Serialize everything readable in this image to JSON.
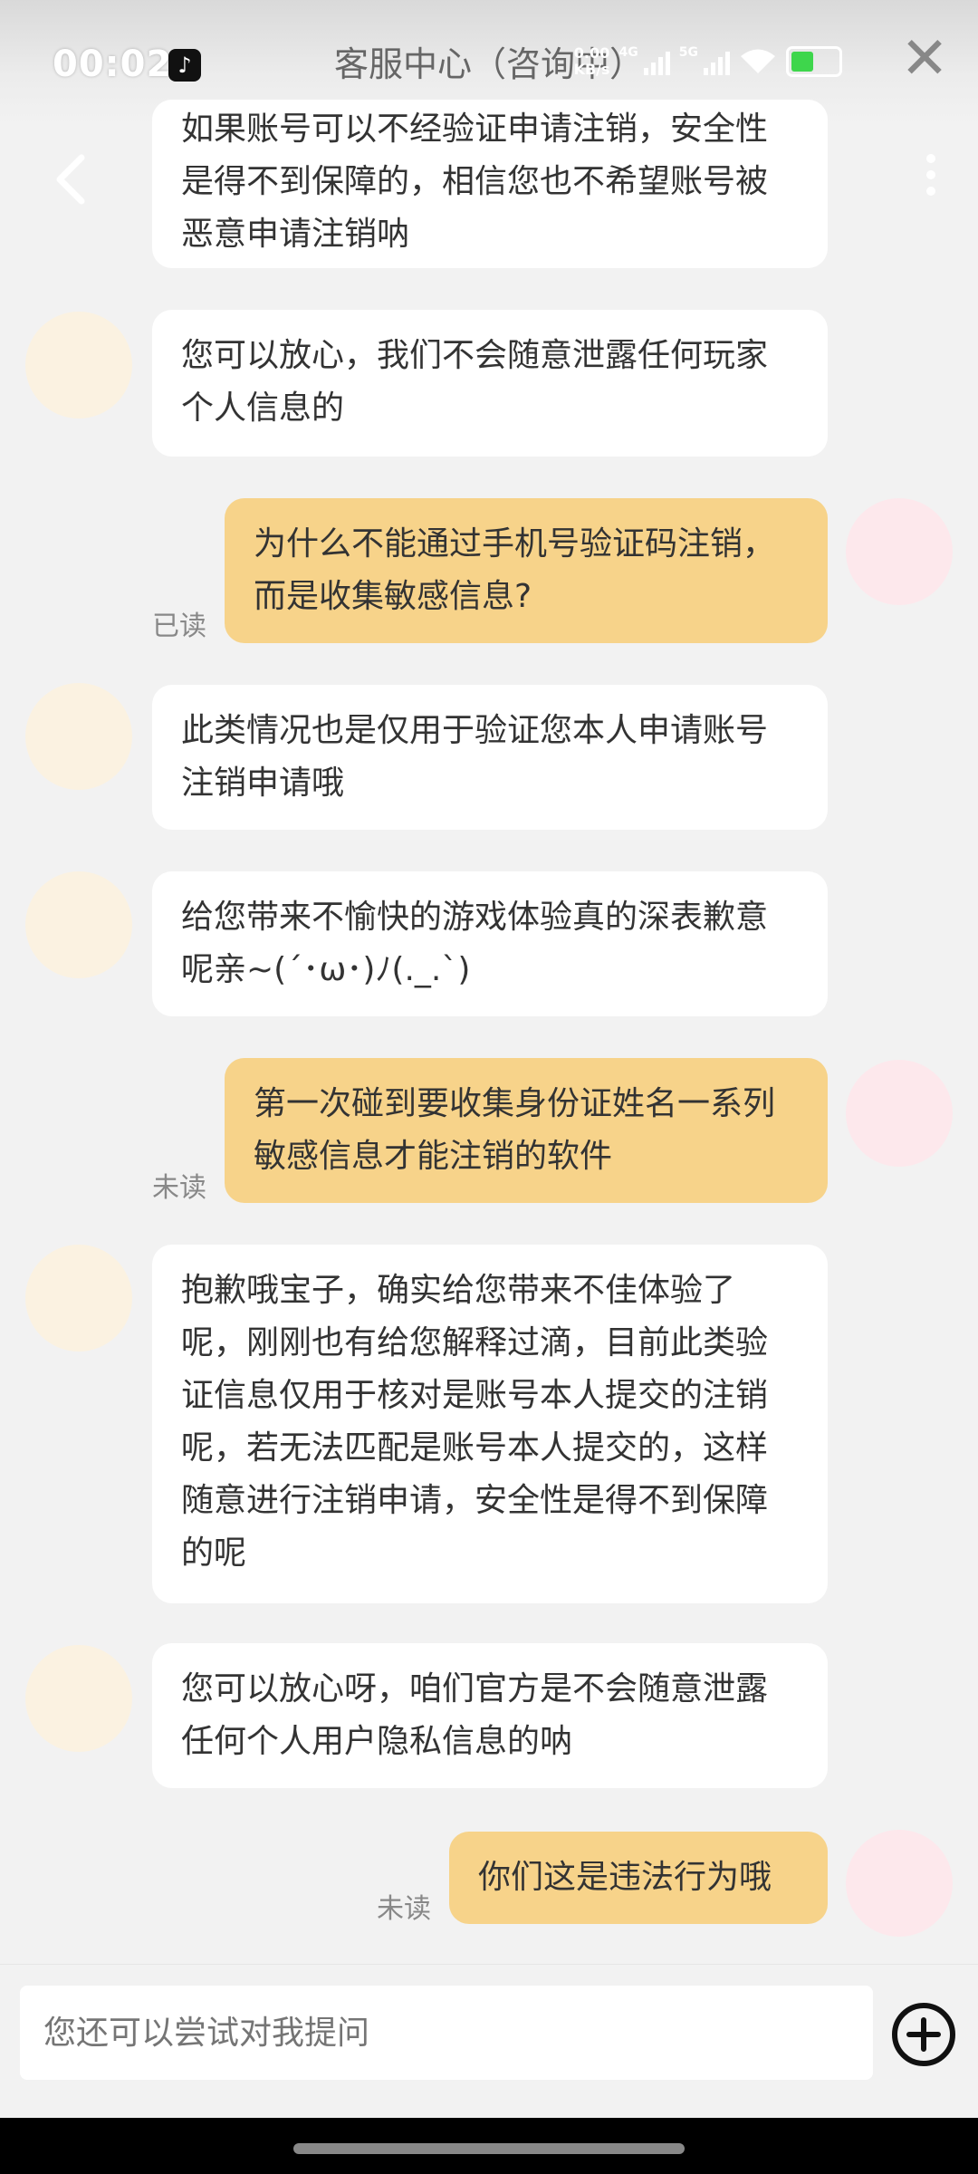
{
  "status_bar": {
    "time": "00:02",
    "speed": "0.00",
    "speed_unit": "KB/s",
    "net1": "4G",
    "net2": "5G"
  },
  "header": {
    "title": "客服中心（咨询中）"
  },
  "messages": [
    {
      "from": "bot",
      "text": "如果账号可以不经验证申请注销，安全性是得不到保障的，相信您也不希望账号被恶意申请注销呐"
    },
    {
      "from": "bot",
      "text": "您可以放心，我们不会随意泄露任何玩家个人信息的"
    },
    {
      "from": "me",
      "text": "为什么不能通过手机号验证码注销，而是收集敏感信息?",
      "status": "已读"
    },
    {
      "from": "bot",
      "text": "此类情况也是仅用于验证您本人申请账号注销申请哦"
    },
    {
      "from": "bot",
      "text": "给您带来不愉快的游戏体验真的深表歉意呢亲~(´･ω･)ﾉ(._.`)"
    },
    {
      "from": "me",
      "text": "第一次碰到要收集身份证姓名一系列敏感信息才能注销的软件",
      "status": "未读"
    },
    {
      "from": "bot",
      "text": "抱歉哦宝子，确实给您带来不佳体验了呢，刚刚也有给您解释过滴，目前此类验证信息仅用于核对是账号本人提交的注销呢，若无法匹配是账号本人提交的，这样随意进行注销申请，安全性是得不到保障的呢"
    },
    {
      "from": "bot",
      "text": "您可以放心呀，咱们官方是不会随意泄露任何个人用户隐私信息的呐"
    },
    {
      "from": "me",
      "text": "你们这是违法行为哦",
      "status": "未读"
    }
  ],
  "composer": {
    "placeholder": "您还可以尝试对我提问"
  },
  "colors": {
    "user_bubble": "#f7d38a",
    "bot_bubble": "#ffffff",
    "background": "#f2f2f2"
  },
  "icons": [
    "back-arrow-icon",
    "more-icon",
    "close-icon",
    "tiktok-icon",
    "wifi-icon",
    "battery-icon",
    "add-icon"
  ]
}
